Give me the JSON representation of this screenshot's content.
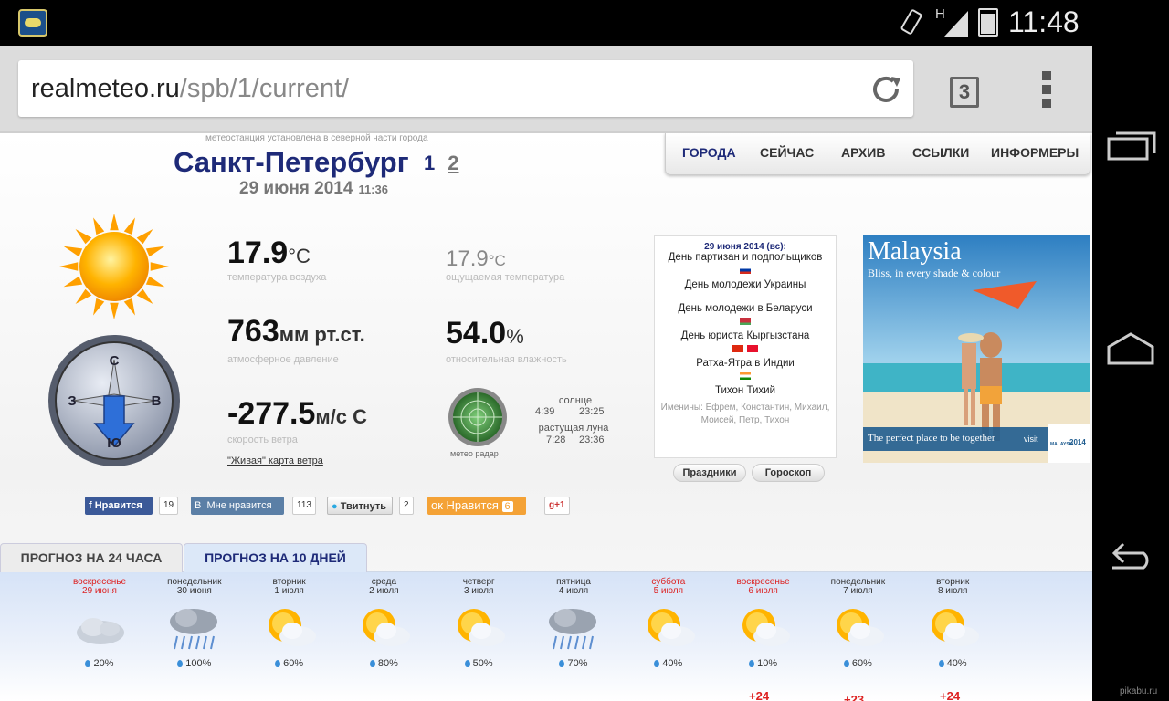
{
  "status_bar": {
    "network": "H",
    "time": "11:48"
  },
  "browser": {
    "url_host": "realmeteo.ru",
    "url_path": "/spb/1/current/",
    "tab_count": "3"
  },
  "site": {
    "station_note": "метеостанция установлена в северной части города",
    "city": "Санкт-Петербург",
    "city_links": [
      "1",
      "2"
    ],
    "date": "29 июня 2014",
    "time": "11:36",
    "nav": [
      "ГОРОДА",
      "СЕЙЧАС",
      "АРХИВ",
      "ССЫЛКИ",
      "ИНФОРМЕРЫ"
    ]
  },
  "weather": {
    "temperature": {
      "value": "17.9",
      "unit": "°C",
      "label": "температура воздуха"
    },
    "feels_like": {
      "value": "17.9",
      "unit": "°C",
      "label": "ощущаемая температура"
    },
    "pressure": {
      "value": "763",
      "unit": "мм рт.ст.",
      "label": "атмосферное давление"
    },
    "humidity": {
      "value": "54.0",
      "unit": "%",
      "label": "относительная влажность"
    },
    "wind": {
      "value": "-277.5",
      "unit": "м/с С",
      "label": "скорость ветра"
    },
    "wind_map_link": "\"Живая\" карта ветра",
    "compass": {
      "n": "С",
      "w": "З",
      "e": "В",
      "s": "Ю"
    },
    "radar_label": "метео радар",
    "sun": {
      "label": "солнце",
      "rise": "4:39",
      "set": "23:25"
    },
    "moon": {
      "label": "растущая луна",
      "rise": "7:28",
      "set": "23:36"
    }
  },
  "holidays": {
    "header": "29 июня 2014 (вс):",
    "items": [
      "День партизан и подпольщиков",
      "День молодежи Украины",
      "День молодежи в Беларуси",
      "День юриста Кыргызстана",
      "Ратха-Ятра в Индии",
      "Тихон Тихий"
    ],
    "names_line1": "Именины: Ефрем, Константин, Михаил,",
    "names_line2": "Моисей, Петр, Тихон",
    "button_holidays": "Праздники",
    "button_horoscope": "Гороскоп"
  },
  "ad": {
    "title": "Malaysia",
    "subtitle": "Bliss, in every shade & colour",
    "tagline": "The perfect place to be together",
    "badge_visit": "visit",
    "badge_country": "MALAYSIA",
    "badge_year": "2014"
  },
  "social": {
    "fb_label": "Нравится",
    "fb_count": "19",
    "vk_label": "Мне нравится",
    "vk_count": "113",
    "tw_label": "Твитнуть",
    "tw_count": "2",
    "ok_label": "Нравится",
    "ok_count": "6",
    "gplus_label": "+1"
  },
  "forecast_tabs": [
    "ПРОГНОЗ НА 24 ЧАСА",
    "ПРОГНОЗ НА 10 ДНЕЙ"
  ],
  "forecast": [
    {
      "day": "воскресенье",
      "date": "29 июня",
      "precip": "20%",
      "icon": "cloudy-icon",
      "weekend": true
    },
    {
      "day": "понедельник",
      "date": "30 июня",
      "precip": "100%",
      "icon": "rain-icon",
      "weekend": false
    },
    {
      "day": "вторник",
      "date": "1 июля",
      "precip": "60%",
      "icon": "partly-cloudy-icon",
      "weekend": false
    },
    {
      "day": "среда",
      "date": "2 июля",
      "precip": "80%",
      "icon": "partly-cloudy-icon",
      "weekend": false
    },
    {
      "day": "четверг",
      "date": "3 июля",
      "precip": "50%",
      "icon": "partly-cloudy-icon",
      "weekend": false
    },
    {
      "day": "пятница",
      "date": "4 июля",
      "precip": "70%",
      "icon": "rain-icon",
      "weekend": false
    },
    {
      "day": "суббота",
      "date": "5 июля",
      "precip": "40%",
      "icon": "partly-cloudy-icon",
      "weekend": true
    },
    {
      "day": "воскресенье",
      "date": "6 июля",
      "precip": "10%",
      "icon": "partly-cloudy-icon",
      "weekend": true
    },
    {
      "day": "понедельник",
      "date": "7 июля",
      "precip": "60%",
      "icon": "partly-cloudy-icon",
      "weekend": false
    },
    {
      "day": "вторник",
      "date": "8 июля",
      "precip": "40%",
      "icon": "partly-cloudy-icon",
      "weekend": false
    }
  ],
  "forecast_temps": [
    "+24",
    "+23",
    "+24"
  ],
  "watermark": "pikabu.ru"
}
